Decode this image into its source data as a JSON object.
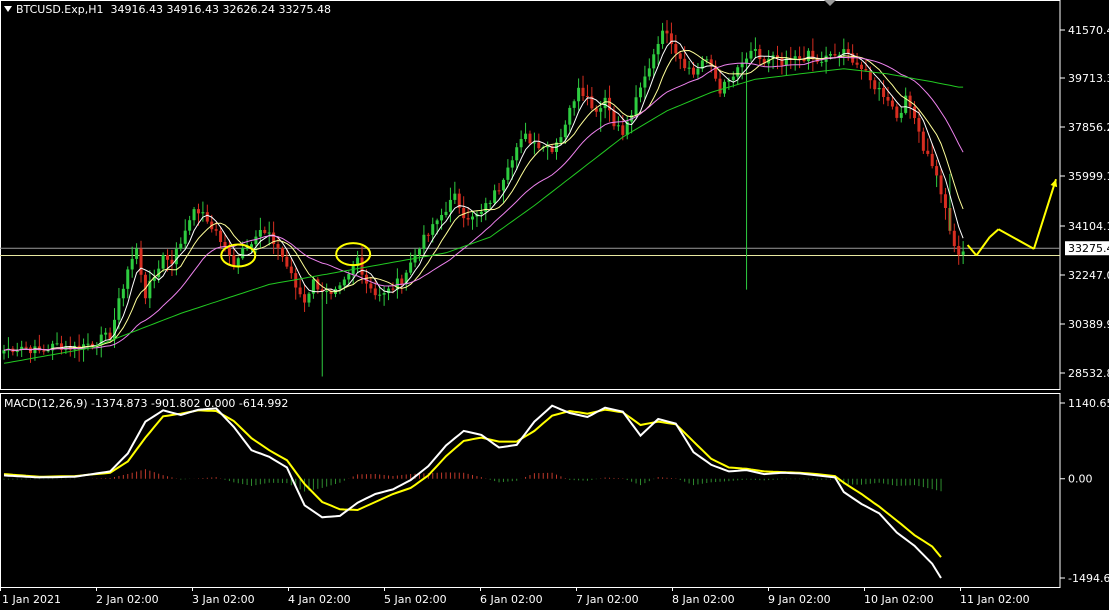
{
  "header": {
    "symbol": "BTCUSD.Exp,H1",
    "ohlc": "34916.43 34916.43 32626.24 33275.48"
  },
  "macd": {
    "label": "MACD(12,26,9) -1374.873 -901.802 0.000 -614.992"
  },
  "chart_data": [
    {
      "type": "candlestick",
      "name": "price",
      "yticks": [
        "41570.4",
        "39713.3",
        "37856.2",
        "35999.1",
        "34104.1",
        "32247.0",
        "30389.9",
        "28532.8"
      ],
      "current_price_label": "33275.4",
      "xticks": [
        "1 Jan 2021",
        "2 Jan 02:00",
        "3 Jan 02:00",
        "4 Jan 02:00",
        "5 Jan 02:00",
        "6 Jan 02:00",
        "7 Jan 02:00",
        "8 Jan 02:00",
        "9 Jan 02:00",
        "10 Jan 02:00",
        "11 Jan 02:00"
      ],
      "close_path": [
        [
          0,
          29400
        ],
        [
          4,
          29550
        ],
        [
          8,
          29350
        ],
        [
          12,
          29600
        ],
        [
          16,
          29500
        ],
        [
          20,
          29700
        ],
        [
          24,
          29950
        ],
        [
          26,
          31200
        ],
        [
          28,
          32500
        ],
        [
          30,
          33200
        ],
        [
          32,
          31500
        ],
        [
          34,
          32200
        ],
        [
          36,
          33000
        ],
        [
          38,
          32800
        ],
        [
          40,
          33500
        ],
        [
          42,
          34500
        ],
        [
          44,
          34700
        ],
        [
          46,
          34300
        ],
        [
          48,
          33900
        ],
        [
          50,
          33200
        ],
        [
          52,
          32700
        ],
        [
          54,
          33300
        ],
        [
          56,
          33600
        ],
        [
          58,
          33900
        ],
        [
          60,
          33700
        ],
        [
          62,
          33300
        ],
        [
          64,
          32600
        ],
        [
          66,
          31800
        ],
        [
          68,
          31300
        ],
        [
          70,
          32000
        ],
        [
          72,
          31700
        ],
        [
          74,
          31400
        ],
        [
          76,
          31700
        ],
        [
          78,
          32200
        ],
        [
          80,
          32900
        ],
        [
          82,
          32000
        ],
        [
          84,
          31600
        ],
        [
          86,
          31500
        ],
        [
          88,
          31800
        ],
        [
          90,
          32100
        ],
        [
          92,
          32700
        ],
        [
          94,
          33400
        ],
        [
          96,
          33800
        ],
        [
          98,
          34300
        ],
        [
          100,
          34800
        ],
        [
          102,
          35200
        ],
        [
          104,
          34600
        ],
        [
          106,
          34400
        ],
        [
          108,
          34600
        ],
        [
          110,
          35100
        ],
        [
          112,
          35600
        ],
        [
          114,
          36500
        ],
        [
          116,
          37100
        ],
        [
          118,
          37500
        ],
        [
          120,
          37300
        ],
        [
          122,
          37200
        ],
        [
          124,
          37100
        ],
        [
          126,
          37600
        ],
        [
          128,
          38500
        ],
        [
          130,
          39500
        ],
        [
          132,
          39000
        ],
        [
          134,
          38500
        ],
        [
          136,
          39000
        ],
        [
          138,
          38100
        ],
        [
          140,
          37600
        ],
        [
          142,
          38400
        ],
        [
          144,
          39300
        ],
        [
          146,
          40200
        ],
        [
          148,
          41200
        ],
        [
          150,
          41600
        ],
        [
          152,
          40800
        ],
        [
          154,
          40300
        ],
        [
          156,
          39900
        ],
        [
          158,
          40400
        ],
        [
          160,
          40200
        ],
        [
          162,
          39300
        ],
        [
          164,
          39600
        ],
        [
          166,
          40000
        ],
        [
          168,
          40500
        ],
        [
          170,
          40700
        ],
        [
          172,
          40300
        ],
        [
          174,
          40500
        ],
        [
          176,
          40200
        ],
        [
          178,
          40400
        ],
        [
          180,
          40500
        ],
        [
          182,
          40600
        ],
        [
          184,
          40300
        ],
        [
          186,
          40500
        ],
        [
          188,
          40600
        ],
        [
          190,
          40700
        ],
        [
          192,
          40500
        ],
        [
          194,
          40100
        ],
        [
          196,
          39600
        ],
        [
          198,
          39300
        ],
        [
          200,
          39000
        ],
        [
          202,
          38300
        ],
        [
          204,
          38900
        ],
        [
          206,
          38400
        ],
        [
          208,
          37100
        ],
        [
          210,
          36500
        ],
        [
          212,
          35400
        ],
        [
          214,
          33900
        ],
        [
          216,
          32900
        ],
        [
          217,
          33275
        ]
      ],
      "ma_series": [
        {
          "color": "#ffffff",
          "period_hint": "fast",
          "lag": 2
        },
        {
          "color": "#ffff99",
          "period_hint": "mid",
          "lag": 4
        },
        {
          "color": "#ee82ee",
          "period_hint": "slow",
          "lag": 8
        },
        {
          "color": "#22c922",
          "period_hint": "long",
          "lag": 0
        }
      ],
      "long_ma_path": [
        [
          0,
          28900
        ],
        [
          20,
          29500
        ],
        [
          40,
          30800
        ],
        [
          60,
          31900
        ],
        [
          80,
          32500
        ],
        [
          100,
          33100
        ],
        [
          110,
          33700
        ],
        [
          120,
          34900
        ],
        [
          130,
          36200
        ],
        [
          140,
          37500
        ],
        [
          150,
          38500
        ],
        [
          160,
          39200
        ],
        [
          170,
          39700
        ],
        [
          180,
          39900
        ],
        [
          190,
          40100
        ],
        [
          200,
          39900
        ],
        [
          210,
          39600
        ],
        [
          216,
          39400
        ]
      ],
      "horizontal_lines": [
        {
          "price": 33275,
          "color": "#9a9a9a"
        },
        {
          "price": 33000,
          "color": "#e8e8a0"
        }
      ],
      "annotations": [
        {
          "kind": "ellipse",
          "bar": 53,
          "price": 33000,
          "color": "#ffff00"
        },
        {
          "kind": "ellipse",
          "bar": 79,
          "price": 33050,
          "color": "#ffff00"
        },
        {
          "kind": "zigzag",
          "color": "#ffff00",
          "points": [
            [
              218,
              33400
            ],
            [
              220,
              33000
            ],
            [
              223,
              33700
            ],
            [
              225,
              34000
            ],
            [
              233,
              33250
            ],
            [
              238,
              35900
            ]
          ]
        }
      ]
    },
    {
      "type": "macd",
      "name": "MACD(12,26,9)",
      "yticks": [
        "1140.65",
        "0.00",
        "-1494.6"
      ],
      "ylim": [
        -1494.6,
        1140.65
      ],
      "macd_path": [
        [
          0,
          50
        ],
        [
          8,
          20
        ],
        [
          16,
          30
        ],
        [
          24,
          110
        ],
        [
          28,
          380
        ],
        [
          32,
          860
        ],
        [
          36,
          1030
        ],
        [
          40,
          960
        ],
        [
          44,
          1040
        ],
        [
          48,
          1060
        ],
        [
          52,
          780
        ],
        [
          56,
          430
        ],
        [
          60,
          330
        ],
        [
          64,
          170
        ],
        [
          68,
          -400
        ],
        [
          72,
          -580
        ],
        [
          76,
          -560
        ],
        [
          80,
          -360
        ],
        [
          84,
          -230
        ],
        [
          88,
          -160
        ],
        [
          92,
          -20
        ],
        [
          96,
          190
        ],
        [
          100,
          500
        ],
        [
          104,
          720
        ],
        [
          108,
          660
        ],
        [
          112,
          470
        ],
        [
          116,
          510
        ],
        [
          120,
          860
        ],
        [
          124,
          1100
        ],
        [
          128,
          990
        ],
        [
          132,
          930
        ],
        [
          136,
          1070
        ],
        [
          140,
          1010
        ],
        [
          144,
          650
        ],
        [
          148,
          900
        ],
        [
          152,
          830
        ],
        [
          156,
          400
        ],
        [
          160,
          210
        ],
        [
          164,
          110
        ],
        [
          168,
          130
        ],
        [
          172,
          70
        ],
        [
          176,
          90
        ],
        [
          180,
          80
        ],
        [
          184,
          50
        ],
        [
          188,
          20
        ],
        [
          190,
          -200
        ],
        [
          194,
          -380
        ],
        [
          198,
          -520
        ],
        [
          202,
          -810
        ],
        [
          206,
          -1010
        ],
        [
          210,
          -1280
        ],
        [
          212,
          -1494
        ]
      ],
      "signal_path": [
        [
          0,
          70
        ],
        [
          8,
          30
        ],
        [
          16,
          40
        ],
        [
          24,
          90
        ],
        [
          28,
          260
        ],
        [
          32,
          620
        ],
        [
          36,
          940
        ],
        [
          40,
          980
        ],
        [
          44,
          1030
        ],
        [
          48,
          1020
        ],
        [
          52,
          870
        ],
        [
          56,
          610
        ],
        [
          60,
          430
        ],
        [
          64,
          280
        ],
        [
          68,
          -80
        ],
        [
          72,
          -350
        ],
        [
          76,
          -460
        ],
        [
          80,
          -470
        ],
        [
          84,
          -350
        ],
        [
          88,
          -230
        ],
        [
          92,
          -140
        ],
        [
          96,
          50
        ],
        [
          100,
          340
        ],
        [
          104,
          570
        ],
        [
          108,
          620
        ],
        [
          112,
          560
        ],
        [
          116,
          560
        ],
        [
          120,
          720
        ],
        [
          124,
          950
        ],
        [
          128,
          1020
        ],
        [
          132,
          980
        ],
        [
          136,
          1040
        ],
        [
          140,
          1000
        ],
        [
          144,
          810
        ],
        [
          148,
          860
        ],
        [
          152,
          820
        ],
        [
          156,
          560
        ],
        [
          160,
          300
        ],
        [
          164,
          170
        ],
        [
          168,
          150
        ],
        [
          172,
          110
        ],
        [
          176,
          100
        ],
        [
          180,
          90
        ],
        [
          184,
          70
        ],
        [
          188,
          40
        ],
        [
          190,
          -60
        ],
        [
          194,
          -230
        ],
        [
          198,
          -420
        ],
        [
          202,
          -630
        ],
        [
          206,
          -850
        ],
        [
          210,
          -1020
        ],
        [
          212,
          -1180
        ]
      ],
      "colors": {
        "macd": "#ffffff",
        "signal": "#ffff00",
        "hist_up": "#c0392b",
        "hist_down": "#2e8b2e"
      }
    }
  ]
}
